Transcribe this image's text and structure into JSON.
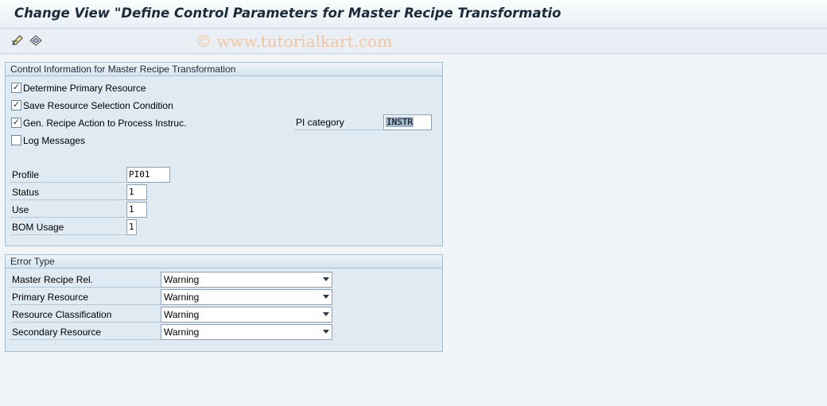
{
  "window": {
    "title": "Change View \"Define Control Parameters for Master Recipe Transformatio"
  },
  "toolbar": {
    "watermark": "© www.tutorialkart.com",
    "icons": [
      "edit-pencil-icon",
      "other-entry-icon"
    ]
  },
  "control_group": {
    "title": "Control Information for Master Recipe Transformation",
    "checkboxes": [
      {
        "label": "Determine Primary Resource",
        "checked": true
      },
      {
        "label": "Save Resource Selection Condition",
        "checked": true
      },
      {
        "label": "Gen. Recipe Action to Process Instruc.",
        "checked": true
      },
      {
        "label": "Log Messages",
        "checked": false
      }
    ],
    "pi_category": {
      "label": "PI category",
      "value": "INSTR"
    },
    "fields": [
      {
        "label": "Profile",
        "value": "PI01"
      },
      {
        "label": "Status",
        "value": "1"
      },
      {
        "label": "Use",
        "value": "1"
      },
      {
        "label": "BOM Usage",
        "value": "1"
      }
    ]
  },
  "error_group": {
    "title": "Error Type",
    "rows": [
      {
        "label": "Master Recipe Rel.",
        "value": "Warning"
      },
      {
        "label": "Primary Resource",
        "value": "Warning"
      },
      {
        "label": "Resource Classification",
        "value": "Warning"
      },
      {
        "label": "Secondary Resource",
        "value": "Warning"
      }
    ]
  },
  "colors": {
    "group_bg": "#dfeaf2",
    "border": "#a8bfd1",
    "selection": "#9fb6cc"
  }
}
